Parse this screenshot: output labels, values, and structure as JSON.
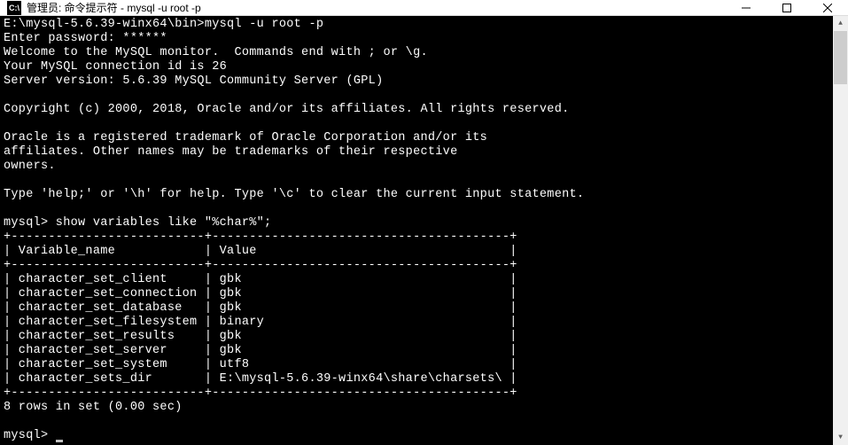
{
  "window": {
    "title": "管理员: 命令提示符 - mysql  -u root -p",
    "icon_label": "C:\\"
  },
  "terminal": {
    "lines": [
      "E:\\mysql-5.6.39-winx64\\bin>mysql -u root -p",
      "Enter password: ******",
      "Welcome to the MySQL monitor.  Commands end with ; or \\g.",
      "Your MySQL connection id is 26",
      "Server version: 5.6.39 MySQL Community Server (GPL)",
      "",
      "Copyright (c) 2000, 2018, Oracle and/or its affiliates. All rights reserved.",
      "",
      "Oracle is a registered trademark of Oracle Corporation and/or its",
      "affiliates. Other names may be trademarks of their respective",
      "owners.",
      "",
      "Type 'help;' or '\\h' for help. Type '\\c' to clear the current input statement.",
      "",
      "mysql> show variables like \"%char%\";",
      "+--------------------------+----------------------------------------+",
      "| Variable_name            | Value                                  |",
      "+--------------------------+----------------------------------------+",
      "| character_set_client     | gbk                                    |",
      "| character_set_connection | gbk                                    |",
      "| character_set_database   | gbk                                    |",
      "| character_set_filesystem | binary                                 |",
      "| character_set_results    | gbk                                    |",
      "| character_set_server     | gbk                                    |",
      "| character_set_system     | utf8                                   |",
      "| character_sets_dir       | E:\\mysql-5.6.39-winx64\\share\\charsets\\ |",
      "+--------------------------+----------------------------------------+",
      "8 rows in set (0.00 sec)",
      "",
      "mysql> "
    ],
    "prompt": "mysql>",
    "command": "show variables like \"%char%\";",
    "table": {
      "headers": [
        "Variable_name",
        "Value"
      ],
      "rows": [
        [
          "character_set_client",
          "gbk"
        ],
        [
          "character_set_connection",
          "gbk"
        ],
        [
          "character_set_database",
          "gbk"
        ],
        [
          "character_set_filesystem",
          "binary"
        ],
        [
          "character_set_results",
          "gbk"
        ],
        [
          "character_set_server",
          "gbk"
        ],
        [
          "character_set_system",
          "utf8"
        ],
        [
          "character_sets_dir",
          "E:\\mysql-5.6.39-winx64\\share\\charsets\\"
        ]
      ]
    },
    "result_summary": "8 rows in set (0.00 sec)"
  }
}
